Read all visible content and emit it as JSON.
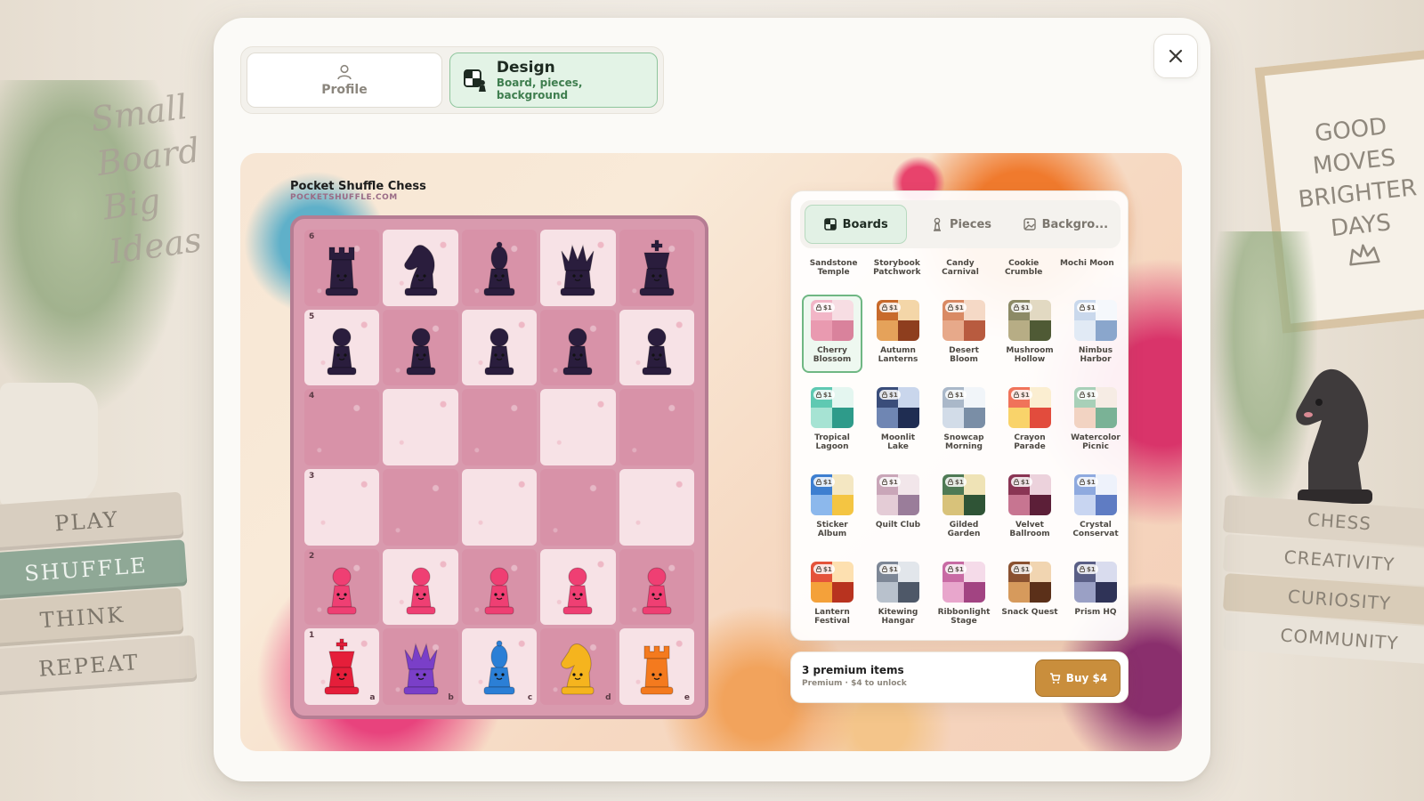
{
  "background": {
    "left_text": [
      "Small",
      "Board",
      "Big",
      "Ideas"
    ],
    "left_books": [
      "PLAY",
      "SHUFFLE",
      "THINK",
      "REPEAT"
    ],
    "frame_text": [
      "GOOD",
      "MOVES",
      "BRIGHTER",
      "DAYS"
    ],
    "right_books": [
      "CHESS",
      "CREATIVITY",
      "CURIOSITY",
      "COMMUNITY"
    ]
  },
  "mode_tabs": {
    "profile": {
      "label": "Profile",
      "icon": "user-icon"
    },
    "design": {
      "title": "Design",
      "subtitle": "Board, pieces, background",
      "icon": "board-pieces-icon",
      "active": true
    }
  },
  "close": {
    "icon": "close-icon"
  },
  "preview": {
    "brand_title": "Pocket Shuffle Chess",
    "brand_url": "POCKETSHUFFLE.COM",
    "ranks": [
      "6",
      "5",
      "4",
      "3",
      "2",
      "1"
    ],
    "files": [
      "a",
      "b",
      "c",
      "d",
      "e"
    ],
    "board_rows": [
      [
        "rook-dark",
        "knight-dark",
        "bishop-dark",
        "queen-dark",
        "king-dark"
      ],
      [
        "pawn-dark",
        "pawn-dark",
        "pawn-dark",
        "pawn-dark",
        "pawn-dark"
      ],
      [
        "",
        "",
        "",
        "",
        ""
      ],
      [
        "",
        "",
        "",
        "",
        ""
      ],
      [
        "pawn-pink",
        "pawn-pink",
        "pawn-pink",
        "pawn-pink",
        "pawn-pink"
      ],
      [
        "king-red",
        "queen-purple",
        "bishop-blue",
        "knight-yellow",
        "rook-orange"
      ]
    ],
    "piece_colors": {
      "dark": "#2a1d3d",
      "pink": "#ef3f73",
      "red": "#e51e3a",
      "purple": "#7a3fc8",
      "blue": "#2b7fd6",
      "yellow": "#f5b41e",
      "orange": "#f47a1e"
    }
  },
  "picker": {
    "tabs": [
      {
        "label": "Boards",
        "icon": "board-icon",
        "active": true
      },
      {
        "label": "Pieces",
        "icon": "pawn-icon",
        "active": false
      },
      {
        "label": "Backgro...",
        "icon": "image-icon",
        "active": false
      }
    ],
    "header_row": [
      "Sandstone Temple",
      "Storybook Patchwork",
      "Candy Carnival",
      "Cookie Crumble",
      "Mochi Moon"
    ],
    "price_badge": "$1",
    "themes": [
      {
        "name": "Cherry Blossom",
        "colors": [
          "#f2b6c7",
          "#d9829c",
          "#e99ab0",
          "#f7dde3"
        ],
        "selected": true
      },
      {
        "name": "Autumn Lanterns",
        "colors": [
          "#c86a2b",
          "#8e3e1e",
          "#e5a25a",
          "#f4d6a8"
        ]
      },
      {
        "name": "Desert Bloom",
        "colors": [
          "#d98a64",
          "#b85b3f",
          "#e7a98a",
          "#f5d9c6"
        ]
      },
      {
        "name": "Mushroom Hollow",
        "colors": [
          "#8c8a66",
          "#4f5a35",
          "#b7ad85",
          "#e2d9c2"
        ]
      },
      {
        "name": "Nimbus Harbor",
        "colors": [
          "#c9d8ec",
          "#8aa6cc",
          "#e1eaf5",
          "#f5f8fc"
        ]
      },
      {
        "name": "Tropical Lagoon",
        "colors": [
          "#5fc9b2",
          "#2e9b8a",
          "#a6e3d3",
          "#e4f6f0"
        ]
      },
      {
        "name": "Moonlit Lake",
        "colors": [
          "#3a4d7a",
          "#1f2d52",
          "#6f86b3",
          "#c9d6ec"
        ]
      },
      {
        "name": "Snowcap Morning",
        "colors": [
          "#aab8c9",
          "#7a8ea6",
          "#d2dce8",
          "#f1f5f9"
        ]
      },
      {
        "name": "Crayon Parade",
        "colors": [
          "#f0735a",
          "#e24c3d",
          "#f9d36a",
          "#fbeed1"
        ]
      },
      {
        "name": "Watercolor Picnic",
        "colors": [
          "#a8d0b8",
          "#7ab296",
          "#f2d3c2",
          "#f6ece4"
        ]
      },
      {
        "name": "Sticker Album",
        "colors": [
          "#3e7fd0",
          "#f4c542",
          "#8cb8ec",
          "#f4e7c2"
        ]
      },
      {
        "name": "Quilt Club",
        "colors": [
          "#c9a6b8",
          "#9a7d9a",
          "#e4ccd6",
          "#f2e6ea"
        ]
      },
      {
        "name": "Gilded Garden",
        "colors": [
          "#4f7a55",
          "#2f5436",
          "#d8c27a",
          "#efe3b6"
        ]
      },
      {
        "name": "Velvet Ballroom",
        "colors": [
          "#8a3554",
          "#5c1f38",
          "#c77591",
          "#ecd2dc"
        ]
      },
      {
        "name": "Crystal Conservat",
        "colors": [
          "#8faadf",
          "#5f7cc3",
          "#c8d5f1",
          "#eef2fb"
        ]
      },
      {
        "name": "Lantern Festival",
        "colors": [
          "#e4533a",
          "#b8331f",
          "#f4a13a",
          "#fde0b0"
        ]
      },
      {
        "name": "Kitewing Hangar",
        "colors": [
          "#7d8796",
          "#4e5868",
          "#b8c1cc",
          "#e2e6eb"
        ]
      },
      {
        "name": "Ribbonlight Stage",
        "colors": [
          "#c86ba4",
          "#a24482",
          "#e8a6cc",
          "#f5dbe9"
        ]
      },
      {
        "name": "Snack Quest",
        "colors": [
          "#8a5130",
          "#5b3019",
          "#d69a5c",
          "#f1d5b1"
        ]
      },
      {
        "name": "Prism HQ",
        "colors": [
          "#5a5f86",
          "#2f3357",
          "#9aa0c5",
          "#d9dcee"
        ]
      }
    ]
  },
  "buy_bar": {
    "count": "3 premium items",
    "subtitle": "Premium · $4 to unlock",
    "button_label": "Buy $4",
    "button_icon": "cart-icon",
    "accent": "#c98e3c"
  }
}
